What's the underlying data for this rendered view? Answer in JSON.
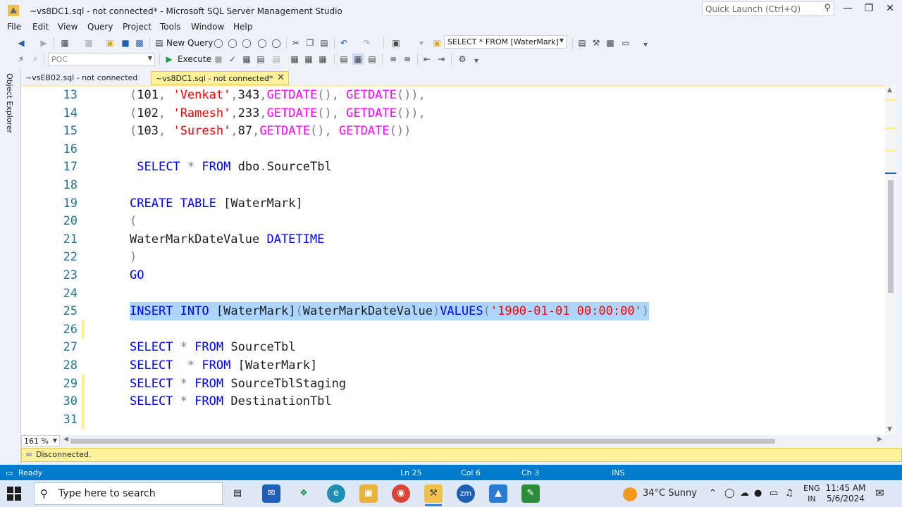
{
  "window": {
    "title": "~vs8DC1.sql - not connected* - Microsoft SQL Server Management Studio",
    "quick_launch_placeholder": "Quick Launch (Ctrl+Q)"
  },
  "menu": [
    "File",
    "Edit",
    "View",
    "Query",
    "Project",
    "Tools",
    "Window",
    "Help"
  ],
  "toolbar": {
    "new_query_label": "New Query",
    "find_combo_value": "SELECT * FROM [WaterMark]",
    "database_combo_value": "POC",
    "execute_label": "Execute"
  },
  "sidebar": {
    "object_explorer_label": "Object Explorer"
  },
  "tabs": [
    {
      "label": "~vsEB02.sql - not connected",
      "active": false
    },
    {
      "label": "~vs8DC1.sql - not connected*",
      "active": true
    }
  ],
  "editor": {
    "lines": [
      {
        "num": "13",
        "segments": [
          [
            "gray",
            "("
          ],
          [
            "txt",
            "101"
          ],
          [
            "gray",
            ", "
          ],
          [
            "str",
            "'Venkat'"
          ],
          [
            "gray",
            ","
          ],
          [
            "txt",
            "343"
          ],
          [
            "gray",
            ","
          ],
          [
            "fn",
            "GETDATE"
          ],
          [
            "gray",
            "(), "
          ],
          [
            "fn",
            "GETDATE"
          ],
          [
            "gray",
            "()),"
          ]
        ],
        "changed": false
      },
      {
        "num": "14",
        "segments": [
          [
            "gray",
            "("
          ],
          [
            "txt",
            "102"
          ],
          [
            "gray",
            ", "
          ],
          [
            "str",
            "'Ramesh'"
          ],
          [
            "gray",
            ","
          ],
          [
            "txt",
            "233"
          ],
          [
            "gray",
            ","
          ],
          [
            "fn",
            "GETDATE"
          ],
          [
            "gray",
            "(), "
          ],
          [
            "fn",
            "GETDATE"
          ],
          [
            "gray",
            "()),"
          ]
        ],
        "changed": false
      },
      {
        "num": "15",
        "segments": [
          [
            "gray",
            "("
          ],
          [
            "txt",
            "103"
          ],
          [
            "gray",
            ", "
          ],
          [
            "str",
            "'Suresh'"
          ],
          [
            "gray",
            ","
          ],
          [
            "txt",
            "87"
          ],
          [
            "gray",
            ","
          ],
          [
            "fn",
            "GETDATE"
          ],
          [
            "gray",
            "(), "
          ],
          [
            "fn",
            "GETDATE"
          ],
          [
            "gray",
            "())"
          ]
        ],
        "changed": false
      },
      {
        "num": "16",
        "segments": [],
        "changed": false
      },
      {
        "num": "17",
        "segments": [
          [
            "txt",
            " "
          ],
          [
            "kw",
            "SELECT"
          ],
          [
            "txt",
            " "
          ],
          [
            "gray",
            "*"
          ],
          [
            "txt",
            " "
          ],
          [
            "kw",
            "FROM"
          ],
          [
            "txt",
            " dbo"
          ],
          [
            "gray",
            "."
          ],
          [
            "txt",
            "SourceTbl"
          ]
        ],
        "changed": false
      },
      {
        "num": "18",
        "segments": [],
        "changed": false
      },
      {
        "num": "19",
        "segments": [
          [
            "kw",
            "CREATE"
          ],
          [
            "txt",
            " "
          ],
          [
            "kw",
            "TABLE"
          ],
          [
            "txt",
            " [WaterMark]"
          ]
        ],
        "changed": false
      },
      {
        "num": "20",
        "segments": [
          [
            "gray",
            "("
          ]
        ],
        "changed": false
      },
      {
        "num": "21",
        "segments": [
          [
            "txt",
            "WaterMarkDateValue "
          ],
          [
            "kw",
            "DATETIME"
          ]
        ],
        "changed": false
      },
      {
        "num": "22",
        "segments": [
          [
            "gray",
            ")"
          ]
        ],
        "changed": false
      },
      {
        "num": "23",
        "segments": [
          [
            "kw",
            "GO"
          ]
        ],
        "changed": false
      },
      {
        "num": "24",
        "segments": [],
        "changed": false
      },
      {
        "num": "25",
        "segments": [
          [
            "kw",
            "INSERT"
          ],
          [
            "txt",
            " "
          ],
          [
            "kw",
            "INTO"
          ],
          [
            "txt",
            " [WaterMark]"
          ],
          [
            "gray",
            "("
          ],
          [
            "txt",
            "WaterMarkDateValue"
          ],
          [
            "gray",
            ")"
          ],
          [
            "kw",
            "VALUES"
          ],
          [
            "gray",
            "("
          ],
          [
            "str",
            "'1900-01-01 00:00:00'"
          ],
          [
            "gray",
            ")"
          ]
        ],
        "changed": false,
        "selected": true
      },
      {
        "num": "26",
        "segments": [],
        "changed": true
      },
      {
        "num": "27",
        "segments": [
          [
            "kw",
            "SELECT"
          ],
          [
            "txt",
            " "
          ],
          [
            "gray",
            "*"
          ],
          [
            "txt",
            " "
          ],
          [
            "kw",
            "FROM"
          ],
          [
            "txt",
            " SourceTbl"
          ]
        ],
        "changed": false
      },
      {
        "num": "28",
        "segments": [
          [
            "kw",
            "SELECT"
          ],
          [
            "txt",
            "  "
          ],
          [
            "gray",
            "*"
          ],
          [
            "txt",
            " "
          ],
          [
            "kw",
            "FROM"
          ],
          [
            "txt",
            " [WaterMark]"
          ]
        ],
        "changed": false
      },
      {
        "num": "29",
        "segments": [
          [
            "kw",
            "SELECT"
          ],
          [
            "txt",
            " "
          ],
          [
            "gray",
            "*"
          ],
          [
            "txt",
            " "
          ],
          [
            "kw",
            "FROM"
          ],
          [
            "txt",
            " SourceTblStaging"
          ]
        ],
        "changed": true
      },
      {
        "num": "30",
        "segments": [
          [
            "kw",
            "SELECT"
          ],
          [
            "txt",
            " "
          ],
          [
            "gray",
            "*"
          ],
          [
            "txt",
            " "
          ],
          [
            "kw",
            "FROM"
          ],
          [
            "txt",
            " DestinationTbl"
          ]
        ],
        "changed": true
      },
      {
        "num": "31",
        "segments": [],
        "changed": true
      }
    ],
    "zoom": "161 %"
  },
  "connection_bar": {
    "text": "Disconnected."
  },
  "statusbar": {
    "ready": "Ready",
    "line": "Ln 25",
    "col": "Col 6",
    "ch": "Ch 3",
    "mode": "INS"
  },
  "taskbar": {
    "search_placeholder": "Type here to search",
    "weather": "34°C  Sunny",
    "lang_top": "ENG",
    "lang_bottom": "IN",
    "time": "11:45 AM",
    "date": "5/6/2024"
  },
  "colors": {
    "keyword": "#0000FF",
    "string": "#FF0000",
    "function": "#FF00FF",
    "operator": "#808080",
    "selection": "#ADD6FF",
    "statusbar": "#007ACC",
    "tab_active": "#FFF29D"
  }
}
